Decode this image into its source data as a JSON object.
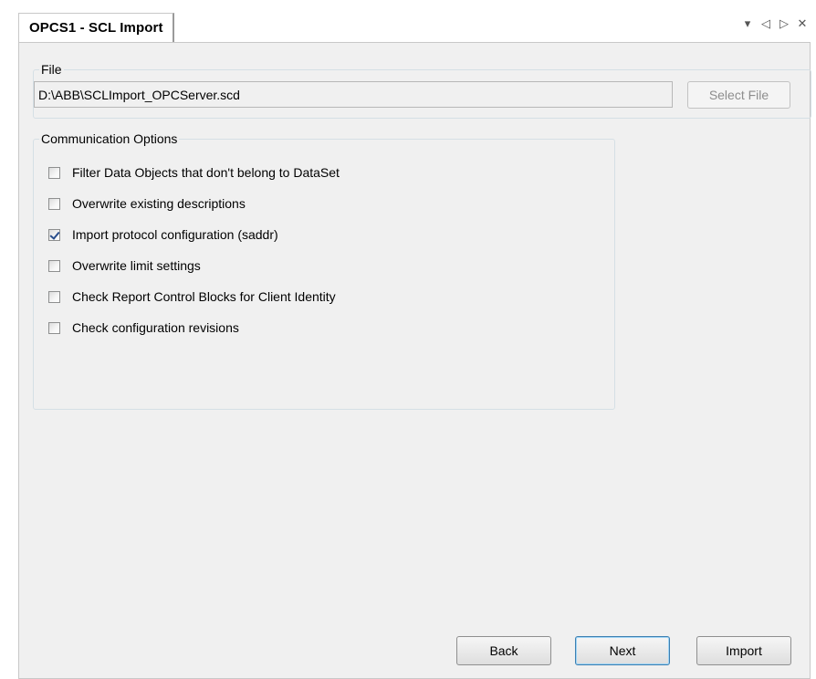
{
  "tab": {
    "title": "OPCS1 - SCL Import",
    "controls": {
      "dropdown_icon": "▾",
      "prev_icon": "◁",
      "next_icon": "▷",
      "close_icon": "✕"
    }
  },
  "file_group": {
    "legend": "File",
    "path_value": "D:\\ABB\\SCLImport_OPCServer.scd",
    "select_button": "Select File"
  },
  "communication_group": {
    "legend": "Communication Options",
    "options": [
      {
        "label": "Filter Data Objects that don't belong to DataSet",
        "checked": false
      },
      {
        "label": "Overwrite existing descriptions",
        "checked": false
      },
      {
        "label": "Import protocol configuration (saddr)",
        "checked": true
      },
      {
        "label": "Overwrite limit settings",
        "checked": false
      },
      {
        "label": "Check Report Control Blocks for Client Identity",
        "checked": false
      },
      {
        "label": "Check configuration revisions",
        "checked": false
      }
    ]
  },
  "buttons": {
    "back": "Back",
    "next": "Next",
    "import": "Import"
  },
  "colors": {
    "panel_bg": "#f0f0f0",
    "default_button_border": "#3c7fb1",
    "checkmark": "#2a4e8c"
  }
}
